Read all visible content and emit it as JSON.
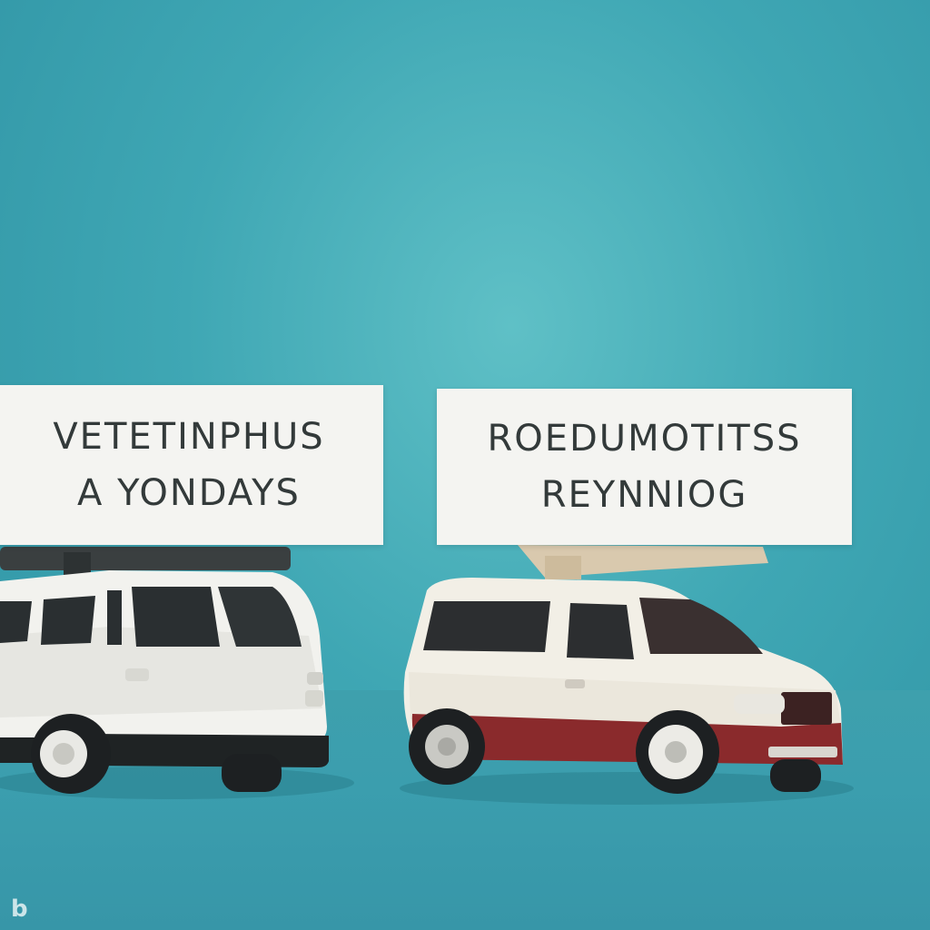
{
  "signs": {
    "left": {
      "line1": "VETETINPHUS",
      "line2": "A YONDAYS"
    },
    "right": {
      "line1": "ROEDUMOTITSS",
      "line2": "REYNNIOG"
    }
  },
  "colors": {
    "background": "#3fa7b4",
    "sign": "#f4f4f1",
    "van_white": "#f2f2ee",
    "van_maroon": "#8a2a2c",
    "text": "#333a3a"
  },
  "icons": {
    "watermark": "bing-logo-icon"
  }
}
